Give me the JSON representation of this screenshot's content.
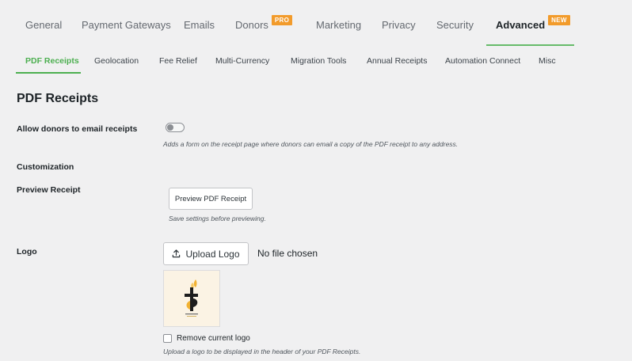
{
  "top_tabs": {
    "items": [
      {
        "label": "General"
      },
      {
        "label": "Payment Gateways"
      },
      {
        "label": "Emails"
      },
      {
        "label": "Donors",
        "badge": "PRO"
      },
      {
        "label": "Marketing"
      },
      {
        "label": "Privacy"
      },
      {
        "label": "Security"
      },
      {
        "label": "Advanced",
        "badge": "NEW"
      }
    ],
    "active": "Advanced"
  },
  "sub_tabs": {
    "items": [
      {
        "label": "PDF Receipts"
      },
      {
        "label": "Geolocation"
      },
      {
        "label": "Fee Relief"
      },
      {
        "label": "Multi-Currency"
      },
      {
        "label": "Migration Tools"
      },
      {
        "label": "Annual Receipts"
      },
      {
        "label": "Automation Connect"
      },
      {
        "label": "Misc"
      }
    ],
    "active": "PDF Receipts"
  },
  "section": {
    "title": "PDF Receipts"
  },
  "settings": {
    "email_receipts": {
      "label": "Allow donors to email receipts",
      "enabled": false,
      "description": "Adds a form on the receipt page where donors can email a copy of the PDF receipt to any address."
    },
    "customization": {
      "label": "Customization"
    },
    "preview": {
      "label": "Preview Receipt",
      "button_label": "Preview PDF Receipt",
      "note": "Save settings before previewing."
    },
    "logo": {
      "label": "Logo",
      "upload_label": "Upload Logo",
      "file_status": "No file chosen",
      "remove_label": "Remove current logo",
      "remove_checked": false,
      "description": "Upload a logo to be displayed in the header of your PDF Receipts."
    }
  },
  "colors": {
    "accent_green": "#4caf50",
    "badge_orange": "#f29b2b",
    "background": "#f0f0f1"
  },
  "icons": {
    "upload": "upload-icon",
    "logo": "cross-logo-icon"
  }
}
